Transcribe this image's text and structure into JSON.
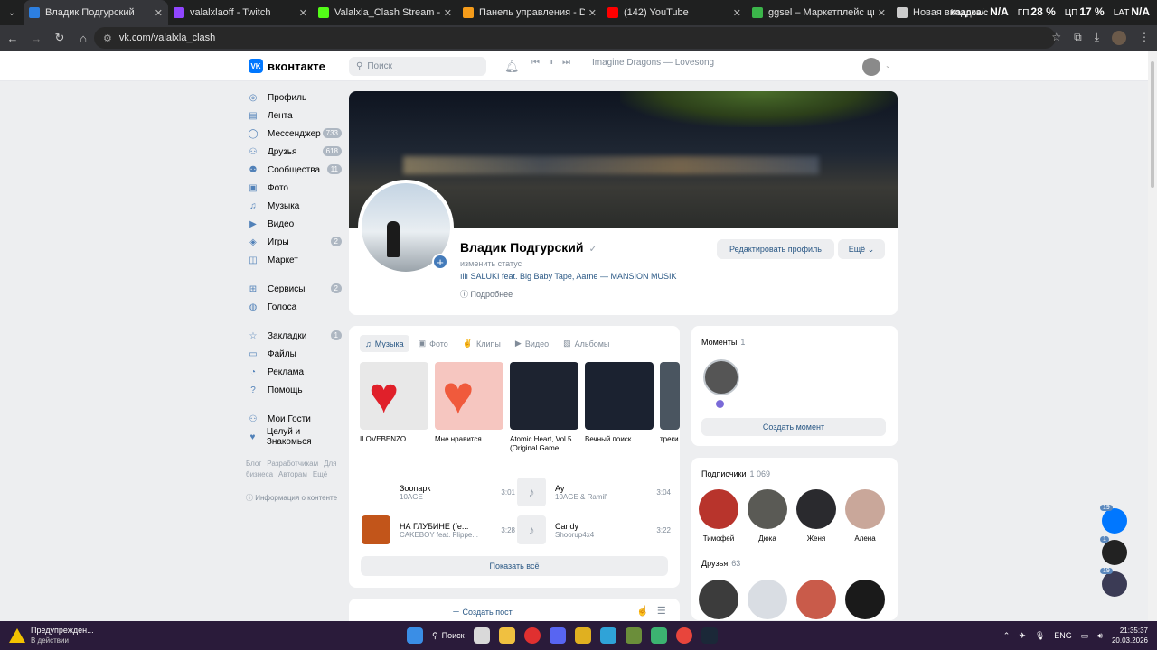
{
  "browser": {
    "tabs": [
      {
        "label": "Владик Подгурский",
        "active": true,
        "favicon_color": "#2d7fe0"
      },
      {
        "label": "valalxlaoff - Twitch",
        "active": false,
        "favicon_color": "#9146ff"
      },
      {
        "label": "Valalxla_Clash Stream - Watch L",
        "active": false,
        "favicon_color": "#53fc18"
      },
      {
        "label": "Панель управления - Donatio",
        "active": false,
        "favicon_color": "#f59c1a"
      },
      {
        "label": "(142) YouTube",
        "active": false,
        "favicon_color": "#ff0000"
      },
      {
        "label": "ggsel – Маркетплейс цифров",
        "active": false,
        "favicon_color": "#3bb54a"
      },
      {
        "label": "Новая вкладка",
        "active": false,
        "favicon_color": "#cccccc"
      }
    ],
    "overlay_stats": [
      {
        "label": "Кадров/с",
        "value": "N/A"
      },
      {
        "label": "ГП",
        "value": "28 %"
      },
      {
        "label": "ЦП",
        "value": "17 %"
      },
      {
        "label": "LAT",
        "value": "N/A"
      }
    ],
    "url": "vk.com/valalxla_clash"
  },
  "header": {
    "logo_text": "вконтакте",
    "search_placeholder": "Поиск",
    "now_playing": "Imagine Dragons — Lovesong"
  },
  "nav": {
    "items": [
      {
        "label": "Профиль",
        "icon": "user-icon",
        "badge": ""
      },
      {
        "label": "Лента",
        "icon": "feed-icon",
        "badge": ""
      },
      {
        "label": "Мессенджер",
        "icon": "chat-icon",
        "badge": "733"
      },
      {
        "label": "Друзья",
        "icon": "friends-icon",
        "badge": "618"
      },
      {
        "label": "Сообщества",
        "icon": "groups-icon",
        "badge": "11"
      },
      {
        "label": "Фото",
        "icon": "photo-icon",
        "badge": ""
      },
      {
        "label": "Музыка",
        "icon": "music-icon",
        "badge": ""
      },
      {
        "label": "Видео",
        "icon": "video-icon",
        "badge": ""
      },
      {
        "label": "Игры",
        "icon": "games-icon",
        "badge": "2"
      },
      {
        "label": "Маркет",
        "icon": "market-icon",
        "badge": ""
      }
    ],
    "items2": [
      {
        "label": "Сервисы",
        "icon": "services-icon",
        "badge": "2"
      },
      {
        "label": "Голоса",
        "icon": "votes-icon",
        "badge": ""
      }
    ],
    "items3": [
      {
        "label": "Закладки",
        "icon": "bookmark-icon",
        "badge": "1"
      },
      {
        "label": "Файлы",
        "icon": "files-icon",
        "badge": ""
      },
      {
        "label": "Реклама",
        "icon": "ads-icon",
        "badge": ""
      },
      {
        "label": "Помощь",
        "icon": "help-icon",
        "badge": ""
      }
    ],
    "items4": [
      {
        "label": "Мои Гости",
        "icon": "guests-icon",
        "badge": ""
      },
      {
        "label": "Целуй и Знакомься",
        "icon": "kiss-icon",
        "badge": ""
      }
    ],
    "footer_links": [
      "Блог",
      "Разработчикам",
      "Для бизнеса",
      "Авторам",
      "Ещё"
    ],
    "info_content": "Информация о контенте"
  },
  "profile": {
    "name": "Владик Подгурский",
    "status": "изменить статус",
    "music_status": "SALUKI feat. Big Baby Tape, Aarne — MANSION MUSIK",
    "more_info": "Подробнее",
    "edit_button": "Редактировать профиль",
    "more_button": "Ещё"
  },
  "media": {
    "tabs": [
      {
        "label": "Музыка",
        "icon": "music-icon",
        "active": true
      },
      {
        "label": "Фото",
        "icon": "photo-icon",
        "active": false
      },
      {
        "label": "Клипы",
        "icon": "clips-icon",
        "active": false
      },
      {
        "label": "Видео",
        "icon": "video-icon",
        "active": false
      },
      {
        "label": "Альбомы",
        "icon": "albums-icon",
        "active": false
      }
    ],
    "albums": [
      {
        "title": "ILOVEBENZO",
        "color": "#e8e8e8"
      },
      {
        "title": "Мне нравится",
        "color": "#f6c6c0"
      },
      {
        "title": "Atomic Heart, Vol.5",
        "subtitle": "(Original Game...",
        "color": "#1d2330"
      },
      {
        "title": "Вечный поиск",
        "color": "#1b2230"
      },
      {
        "title": "треки",
        "color": "#4a5560"
      }
    ],
    "tracks": [
      {
        "title": "Зоопарк",
        "artist": "10AGE",
        "duration": "3:01",
        "color": "#ffffff"
      },
      {
        "title": "Ау",
        "artist": "10AGE & Ramil'",
        "duration": "3:04",
        "color": "#edeef0"
      },
      {
        "title": "НА ГЛУБИНЕ (fe...",
        "artist": "CAKEBOY feat. Flippe...",
        "duration": "3:28",
        "color": "#c2551a"
      },
      {
        "title": "Candy",
        "artist": "Shoorup4x4",
        "duration": "3:22",
        "color": "#edeef0"
      }
    ],
    "show_all": "Показать всё"
  },
  "moments": {
    "title": "Моменты",
    "count": "1",
    "create": "Создать момент"
  },
  "subscribers": {
    "title": "Подписчики",
    "count": "1 069",
    "people": [
      {
        "name": "Тимофей",
        "color": "#b8342c"
      },
      {
        "name": "Дюка",
        "color": "#5a5a55"
      },
      {
        "name": "Женя",
        "color": "#2a2a2e"
      },
      {
        "name": "Алена",
        "color": "#c9a79a"
      }
    ]
  },
  "friends": {
    "title": "Друзья",
    "count": "63",
    "people": [
      {
        "name": "",
        "color": "#3c3c3c"
      },
      {
        "name": "",
        "color": "#d9dde3"
      },
      {
        "name": "",
        "color": "#c95b4a"
      },
      {
        "name": "",
        "color": "#1a1a1a"
      }
    ]
  },
  "composer": {
    "create_post": "Создать пост"
  },
  "edge_chats": [
    {
      "badge": "19",
      "color": "#0077ff"
    },
    {
      "badge": "1",
      "color": "#222222"
    },
    {
      "badge": "19",
      "color": "#3b3b55"
    }
  ],
  "taskbar": {
    "warning_title": "Предупрежден...",
    "warning_sub": "В действии",
    "search_label": "Поиск",
    "lang": "ENG",
    "time": "21:35:37",
    "date": "20.03.2026"
  }
}
